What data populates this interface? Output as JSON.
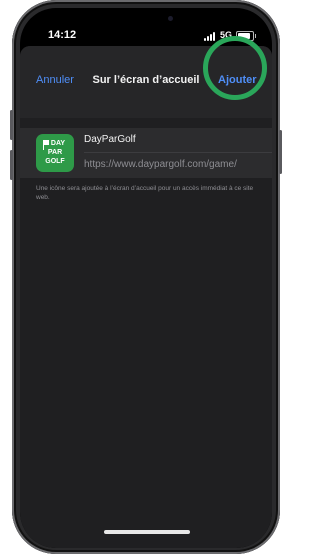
{
  "status_bar": {
    "time": "14:12",
    "network": "5G",
    "battery_level": 0.85
  },
  "navbar": {
    "cancel_label": "Annuler",
    "title": "Sur l’écran d’accueil",
    "add_label": "Ajouter"
  },
  "bookmark": {
    "name": "DayParGolf",
    "url": "https://www.daypargolf.com/game/",
    "icon_text_line1": "DAY",
    "icon_text_line2": "PAR",
    "icon_text_line3": "GOLF"
  },
  "hint": "Une icône sera ajoutée à l’écran d’accueil pour un accès immédiat à ce site web.",
  "colors": {
    "accent": "#4f8ef7",
    "icon_bg": "#2e9a48",
    "highlight": "#2aa65a"
  }
}
